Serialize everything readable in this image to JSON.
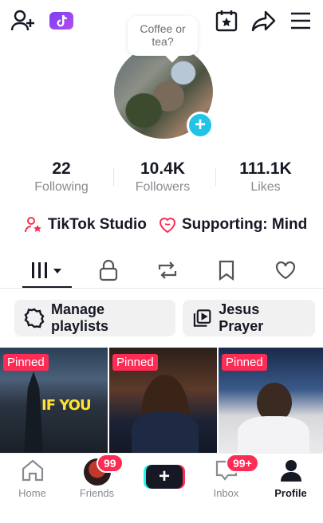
{
  "header": {
    "bubble_text": "Coffee or tea?"
  },
  "stats": [
    {
      "value": "22",
      "label": "Following"
    },
    {
      "value": "10.4K",
      "label": "Followers"
    },
    {
      "value": "111.1K",
      "label": "Likes"
    }
  ],
  "links": {
    "studio": "TikTok Studio",
    "supporting": "Supporting: Mind"
  },
  "chips": {
    "playlists": "Manage playlists",
    "playlist_name": "Jesus Prayer"
  },
  "videos": [
    {
      "badge": "Pinned",
      "overlay": "IF YOU"
    },
    {
      "badge": "Pinned",
      "overlay": ""
    },
    {
      "badge": "Pinned",
      "overlay": ""
    }
  ],
  "bottom_nav": {
    "home": "Home",
    "friends": "Friends",
    "friends_badge": "99",
    "inbox": "Inbox",
    "inbox_badge": "99+",
    "profile": "Profile",
    "plus": "+"
  },
  "colors": {
    "accent": "#fe2c55",
    "cyan": "#20c4e6"
  }
}
